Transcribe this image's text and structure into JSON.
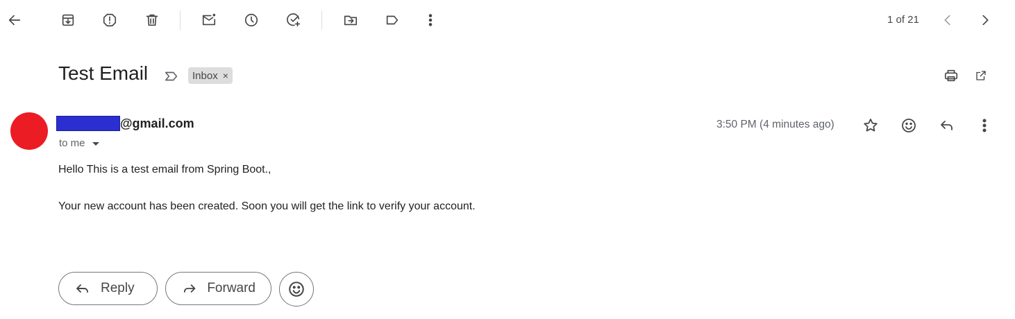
{
  "toolbar": {
    "pager_text": "1 of 21",
    "icons": [
      "back-arrow-icon",
      "archive-icon",
      "report-spam-icon",
      "delete-icon",
      "mark-unread-icon",
      "snooze-icon",
      "add-to-tasks-icon",
      "move-to-icon",
      "label-icon",
      "more-vertical-icon",
      "newer-chevron-icon",
      "older-chevron-icon"
    ]
  },
  "email": {
    "subject": "Test Email",
    "label": "Inbox",
    "label_remove": "×",
    "sender_suffix": "@gmail.com",
    "recipient": "to me",
    "timestamp": "3:50 PM (4 minutes ago)",
    "body": [
      "Hello This is a test email from Spring Boot.,",
      "Your new account has been created. Soon you will get the link to verify your account."
    ]
  },
  "actions": {
    "reply_label": "Reply",
    "forward_label": "Forward"
  },
  "colors": {
    "avatar": "#ec1c24",
    "redaction": "#2b2fd1"
  }
}
